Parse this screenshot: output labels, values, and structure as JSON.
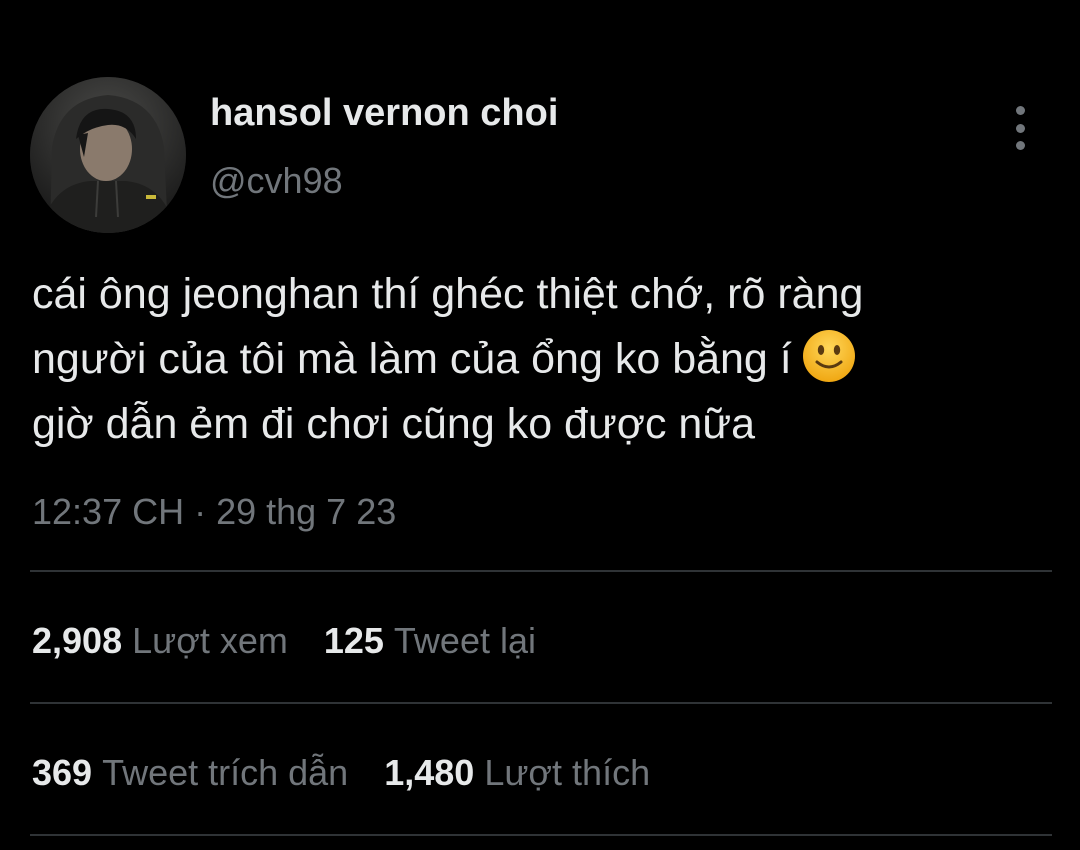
{
  "profile": {
    "display_name": "hansol vernon choi",
    "handle": "@cvh98",
    "avatar_icon": "user-avatar"
  },
  "more_icon": "more-vertical-icon",
  "tweet": {
    "lines": [
      "cái ông jeonghan thí ghéc thiệt chớ, rõ ràng",
      "người của tôi mà làm của ổng ko bằng í",
      "giờ dẫn ẻm đi chơi cũng ko được nữa"
    ],
    "emoji": "slightly-smiling-face-emoji"
  },
  "timestamp": "12:37 CH · 29 thg 7 23",
  "stats": {
    "views": {
      "value": "2,908",
      "label": "Lượt xem"
    },
    "retweets": {
      "value": "125",
      "label": "Tweet lại"
    },
    "quotes": {
      "value": "369",
      "label": "Tweet trích dẫn"
    },
    "likes": {
      "value": "1,480",
      "label": "Lượt thích"
    }
  },
  "colors": {
    "background": "#000000",
    "primary_text": "#e7e9ea",
    "secondary_text": "#71767b",
    "divider": "#2f3336"
  }
}
